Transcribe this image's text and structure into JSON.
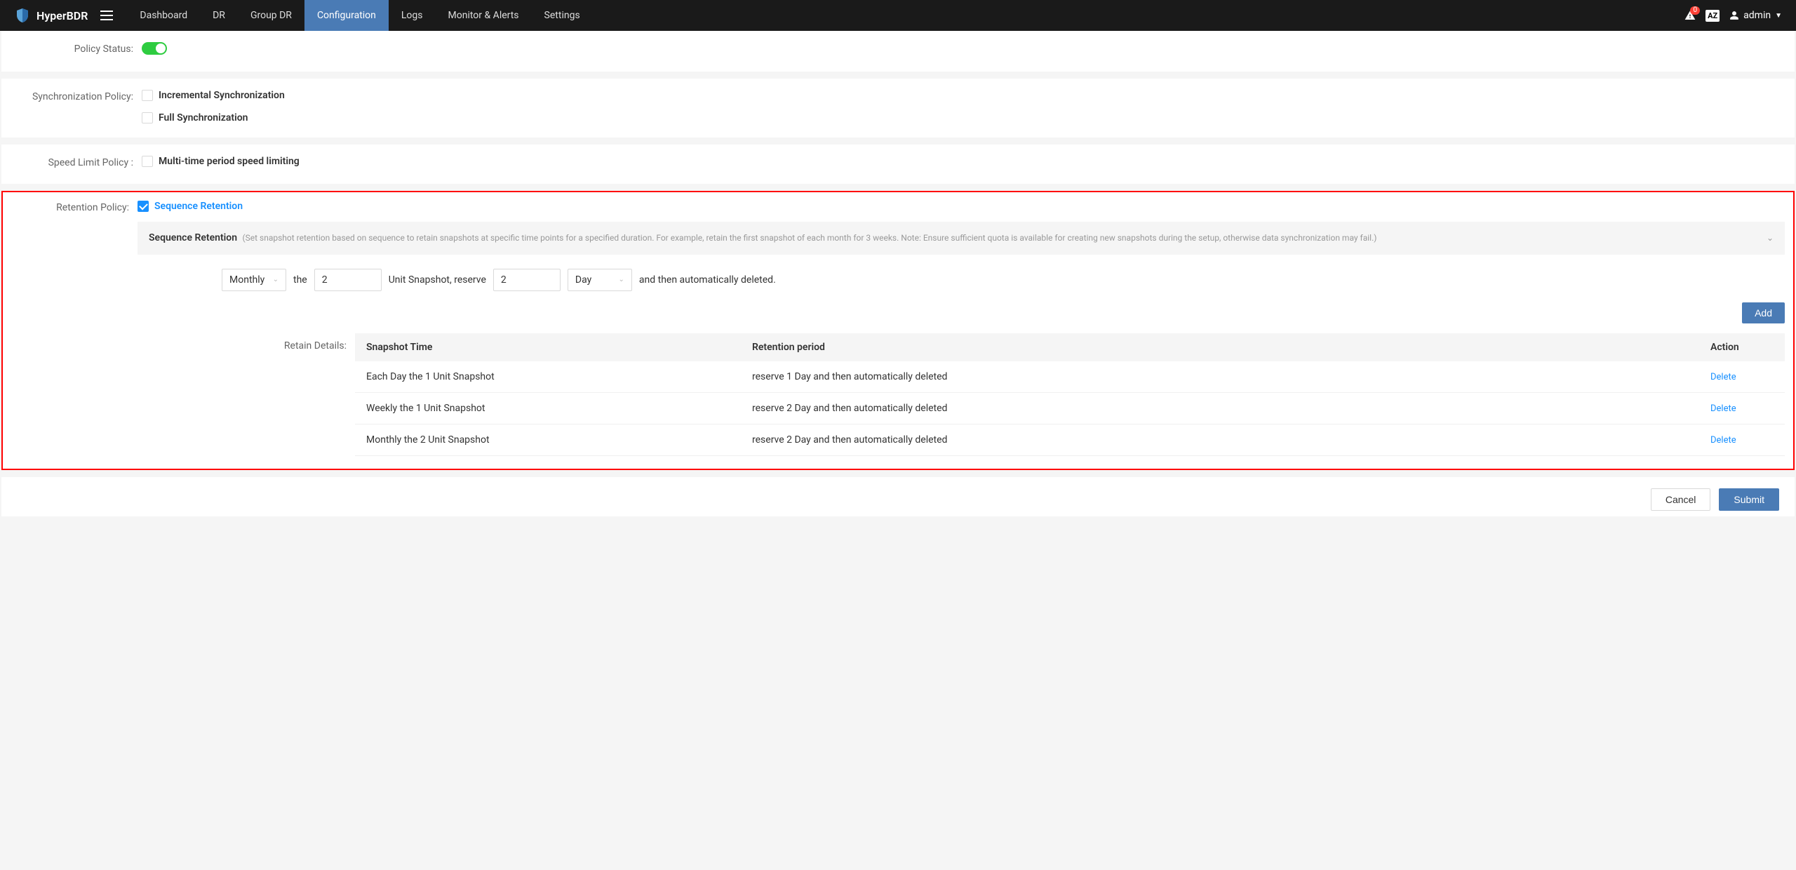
{
  "header": {
    "brand": "HyperBDR",
    "nav": [
      "Dashboard",
      "DR",
      "Group DR",
      "Configuration",
      "Logs",
      "Monitor & Alerts",
      "Settings"
    ],
    "nav_active_index": 3,
    "notif_count": "0",
    "lang": "AZ",
    "user": "admin"
  },
  "policy_status": {
    "label": "Policy Status:",
    "on": true
  },
  "sync_policy": {
    "label": "Synchronization Policy:",
    "options": [
      {
        "label": "Incremental Synchronization",
        "checked": false
      },
      {
        "label": "Full Synchronization",
        "checked": false
      }
    ]
  },
  "speed_policy": {
    "label": "Speed Limit Policy :",
    "option": {
      "label": "Multi-time period speed limiting",
      "checked": false
    }
  },
  "retention": {
    "label": "Retention Policy:",
    "option": {
      "label": "Sequence Retention",
      "checked": true
    },
    "info_title": "Sequence Retention",
    "info_desc": "(Set snapshot retention based on sequence to retain snapshots at specific time points for a specified duration. For example, retain the first snapshot of each month for 3 weeks. Note: Ensure sufficient quota is available for creating new snapshots during the setup, otherwise data synchronization may fail.)",
    "config": {
      "period": "Monthly",
      "the": "the",
      "the_value": "2",
      "unit_text": "Unit Snapshot, reserve",
      "reserve_value": "2",
      "reserve_unit": "Day",
      "tail": "and then automatically deleted."
    },
    "add_label": "Add",
    "details_label": "Retain Details:",
    "columns": [
      "Snapshot Time",
      "Retention period",
      "Action"
    ],
    "rows": [
      {
        "time": "Each Day the 1 Unit Snapshot",
        "period": "reserve 1 Day and then automatically deleted",
        "action": "Delete"
      },
      {
        "time": "Weekly the 1 Unit Snapshot",
        "period": "reserve 2 Day and then automatically deleted",
        "action": "Delete"
      },
      {
        "time": "Monthly the 2 Unit Snapshot",
        "period": "reserve 2 Day and then automatically deleted",
        "action": "Delete"
      }
    ]
  },
  "footer": {
    "cancel": "Cancel",
    "submit": "Submit"
  }
}
